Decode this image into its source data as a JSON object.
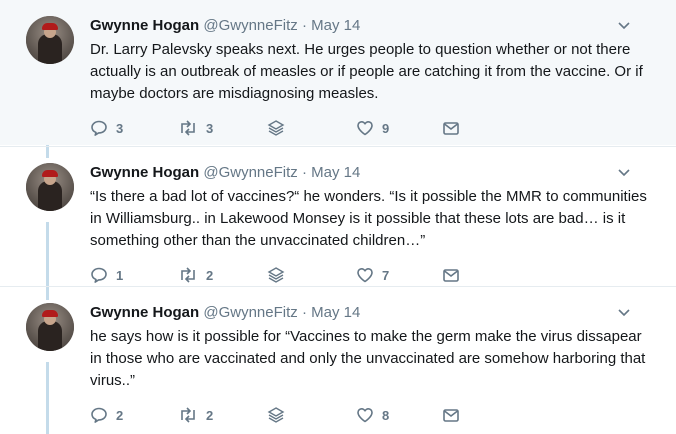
{
  "tweets": [
    {
      "author_name": "Gwynne Hogan",
      "handle": "@GwynneFitz",
      "separator": "·",
      "date": "May 14",
      "text": "Dr. Larry Palevsky speaks next. He urges people to question whether or not there actually is an outbreak of measles or if people are catching it from the vaccine. Or if maybe doctors are misdiagnosing measles.",
      "replies": "3",
      "retweets": "3",
      "likes": "9"
    },
    {
      "author_name": "Gwynne Hogan",
      "handle": "@GwynneFitz",
      "separator": "·",
      "date": "May 14",
      "text": "“Is there a bad lot of vaccines?“ he wonders. “Is it possible the MMR to communities in Williamsburg.. in Lakewood Monsey is it possible that these lots are bad… is it something other than the unvaccinated children…”",
      "replies": "1",
      "retweets": "2",
      "likes": "7"
    },
    {
      "author_name": "Gwynne Hogan",
      "handle": "@GwynneFitz",
      "separator": "·",
      "date": "May 14",
      "text": "he says how is it possible for “Vaccines to make the germ make the virus dissapear in those who are vaccinated and only the unvaccinated are somehow harboring that virus..”",
      "replies": "2",
      "retweets": "2",
      "likes": "8"
    }
  ],
  "icons": {
    "reply": "reply-icon",
    "retweet": "retweet-icon",
    "stack": "stack-icon",
    "like": "heart-icon",
    "message": "envelope-icon",
    "caret": "chevron-down-icon"
  },
  "colors": {
    "thread_line": "#c4dbea",
    "highlight_bg": "#f5f8fa",
    "muted": "#657786"
  }
}
